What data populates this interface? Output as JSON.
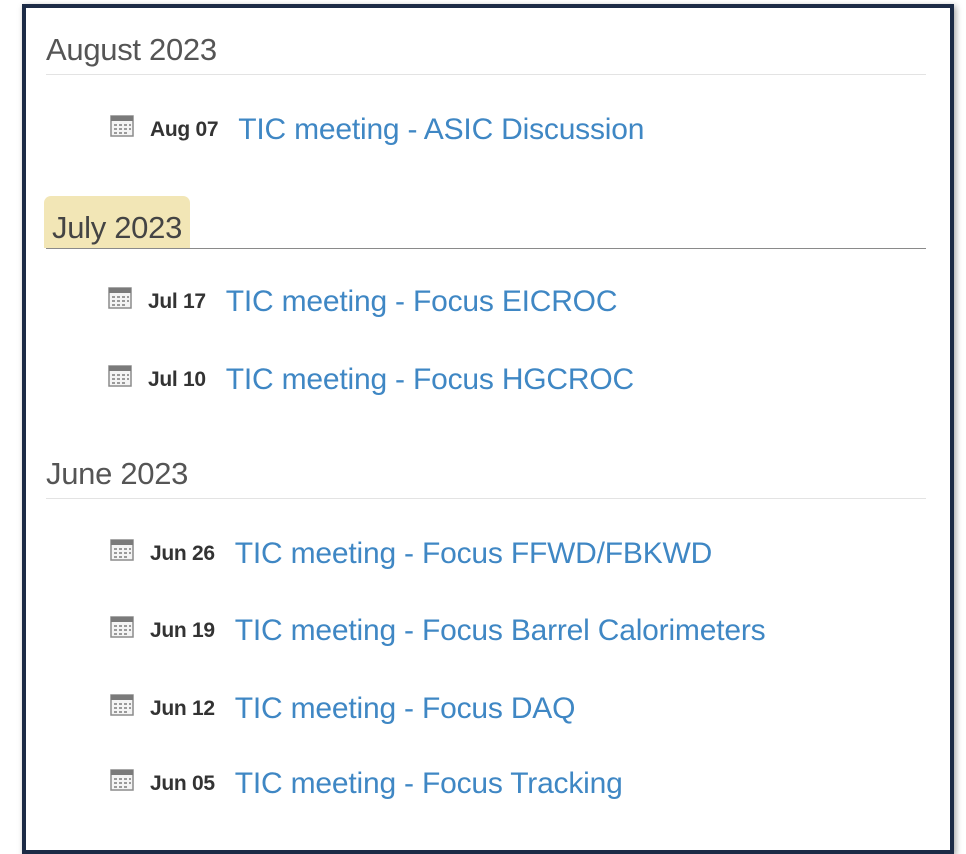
{
  "groups": [
    {
      "month": "August 2023",
      "current": false,
      "events": [
        {
          "date": "Aug 07",
          "title": "TIC meeting - ASIC Discussion",
          "icon": "calendar-icon"
        }
      ]
    },
    {
      "month": "July 2023",
      "current": true,
      "events": [
        {
          "date": "Jul 17",
          "title": "TIC meeting - Focus EICROC",
          "icon": "calendar-icon"
        },
        {
          "date": "Jul 10",
          "title": "TIC meeting - Focus HGCROC",
          "icon": "calendar-icon"
        }
      ]
    },
    {
      "month": "June 2023",
      "current": false,
      "events": [
        {
          "date": "Jun 26",
          "title": "TIC meeting - Focus FFWD/FBKWD",
          "icon": "calendar-icon"
        },
        {
          "date": "Jun 19",
          "title": "TIC meeting - Focus Barrel Calorimeters",
          "icon": "calendar-icon"
        },
        {
          "date": "Jun 12",
          "title": "TIC meeting - Focus DAQ",
          "icon": "calendar-icon"
        },
        {
          "date": "Jun 05",
          "title": "TIC meeting - Focus Tracking",
          "icon": "calendar-icon"
        }
      ]
    }
  ],
  "colors": {
    "link": "#3f87c4",
    "highlight": "#f2e6b6",
    "frame_border": "#1c2b46"
  }
}
